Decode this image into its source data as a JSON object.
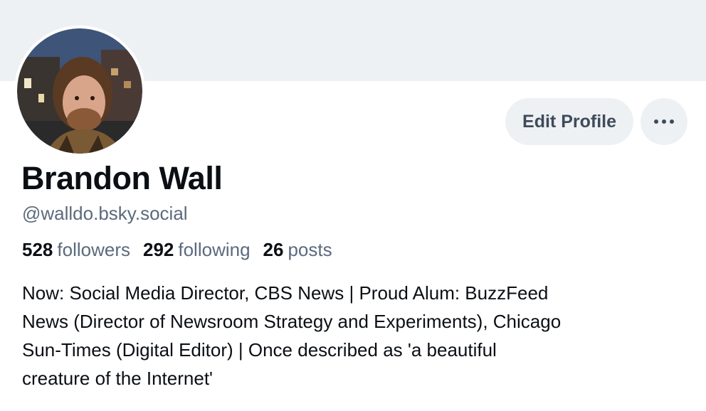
{
  "profile": {
    "display_name": "Brandon Wall",
    "handle": "@walldo.bsky.social",
    "avatar_icon": "user-photo",
    "bio": "Now: Social Media Director, CBS News | Proud Alum: BuzzFeed\nNews (Director of Newsroom Strategy and Experiments), Chicago\nSun-Times (Digital Editor) | Once described as 'a beautiful\ncreature of the Internet'"
  },
  "stats": {
    "followers_count": "528",
    "followers_label": "followers",
    "following_count": "292",
    "following_label": "following",
    "posts_count": "26",
    "posts_label": "posts"
  },
  "actions": {
    "edit_label": "Edit Profile",
    "more_icon": "more-icon"
  },
  "colors": {
    "banner": "#eef1f4",
    "button_bg": "#eef1f4",
    "muted_text": "#5b6a7c",
    "primary_text": "#0b0f14"
  }
}
